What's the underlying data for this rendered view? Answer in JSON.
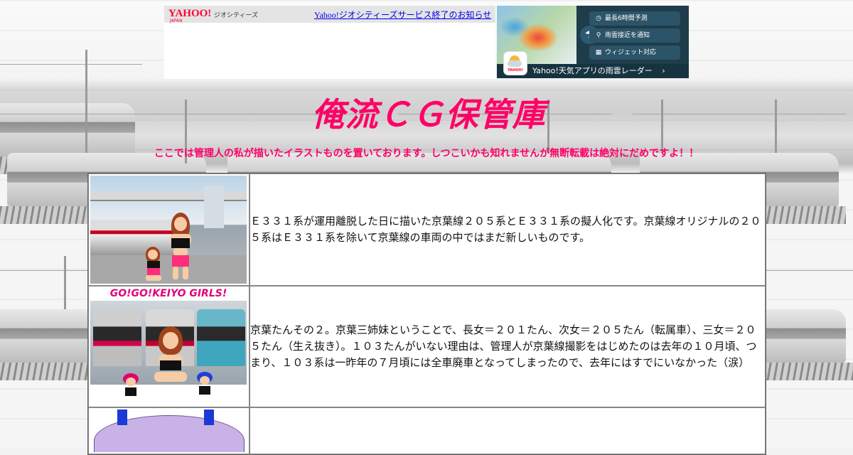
{
  "ads": {
    "left": {
      "logo": "YAHOO!",
      "logo_sub": "JAPAN",
      "brand": "ジオシティーズ",
      "notice_link": "Yahoo!ジオシティーズサービス終了のお知らせ"
    },
    "right": {
      "features": [
        "最長6時間予測",
        "雨雲接近を通知",
        "ウィジェット対応"
      ],
      "feature_icons": [
        "clock-icon",
        "location-pin-icon",
        "widget-icon"
      ],
      "bottom_text": "Yahoo!天気アプリの雨雲レーダー",
      "app_label": "YAHOO!"
    }
  },
  "page": {
    "title": "俺流ＣＧ保管庫",
    "subtitle": "ここでは管理人の私が描いたイラストものを置いております。しつこいかも知れませんが無断転載は絶対にだめですよ！！",
    "accent_color": "#ff0066"
  },
  "gallery": [
    {
      "description": "Ｅ３３１系が運用離脱した日に描いた京葉線２０５系とＥ３３１系の擬人化です。京葉線オリジナルの２０５系はＥ３３１系を除いて京葉線の車両の中ではまだ新しいものです。"
    },
    {
      "banner": "GO!GO!KEIYO GIRLS!",
      "description": "京葉たんその２。京葉三姉妹ということで、長女＝２０１たん、次女＝２０５たん（転属車）、三女＝２０５たん（生え抜き）。１０３たんがいない理由は、管理人が京葉線撮影をはじめたのは去年の１０月頃、つまり、１０３系は一昨年の７月頃には全車廃車となってしまったので、去年にはすでにいなかった（涙）"
    },
    {
      "description": ""
    }
  ]
}
